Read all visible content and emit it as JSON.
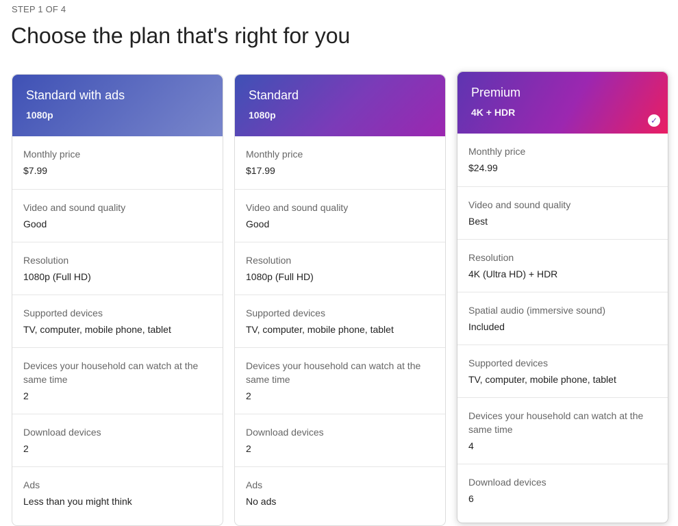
{
  "step_label": "STEP 1 OF 4",
  "title": "Choose the plan that's right for you",
  "colors": {
    "standard_ads_gradient": [
      "#3f51b5",
      "#7986cb"
    ],
    "standard_gradient": [
      "#3f51b5",
      "#9c27b0"
    ],
    "premium_gradient": [
      "#5e35b1",
      "#9c27b0",
      "#e91e63"
    ]
  },
  "plans": [
    {
      "name": "Standard with ads",
      "resolution_badge": "1080p",
      "selected": false,
      "rows": [
        {
          "label": "Monthly price",
          "value": "$7.99"
        },
        {
          "label": "Video and sound quality",
          "value": "Good"
        },
        {
          "label": "Resolution",
          "value": "1080p (Full HD)"
        },
        {
          "label": "Supported devices",
          "value": "TV, computer, mobile phone, tablet"
        },
        {
          "label": "Devices your household can watch at the same time",
          "value": "2"
        },
        {
          "label": "Download devices",
          "value": "2"
        },
        {
          "label": "Ads",
          "value": "Less than you might think"
        }
      ]
    },
    {
      "name": "Standard",
      "resolution_badge": "1080p",
      "selected": false,
      "rows": [
        {
          "label": "Monthly price",
          "value": "$17.99"
        },
        {
          "label": "Video and sound quality",
          "value": "Good"
        },
        {
          "label": "Resolution",
          "value": "1080p (Full HD)"
        },
        {
          "label": "Supported devices",
          "value": "TV, computer, mobile phone, tablet"
        },
        {
          "label": "Devices your household can watch at the same time",
          "value": "2"
        },
        {
          "label": "Download devices",
          "value": "2"
        },
        {
          "label": "Ads",
          "value": "No ads"
        }
      ]
    },
    {
      "name": "Premium",
      "resolution_badge": "4K + HDR",
      "selected": true,
      "check_icon": "check-circle-icon",
      "check_glyph": "✓",
      "rows": [
        {
          "label": "Monthly price",
          "value": "$24.99"
        },
        {
          "label": "Video and sound quality",
          "value": "Best"
        },
        {
          "label": "Resolution",
          "value": "4K (Ultra HD) + HDR"
        },
        {
          "label": "Spatial audio (immersive sound)",
          "value": "Included"
        },
        {
          "label": "Supported devices",
          "value": "TV, computer, mobile phone, tablet"
        },
        {
          "label": "Devices your household can watch at the same time",
          "value": "4"
        },
        {
          "label": "Download devices",
          "value": "6"
        }
      ]
    }
  ]
}
